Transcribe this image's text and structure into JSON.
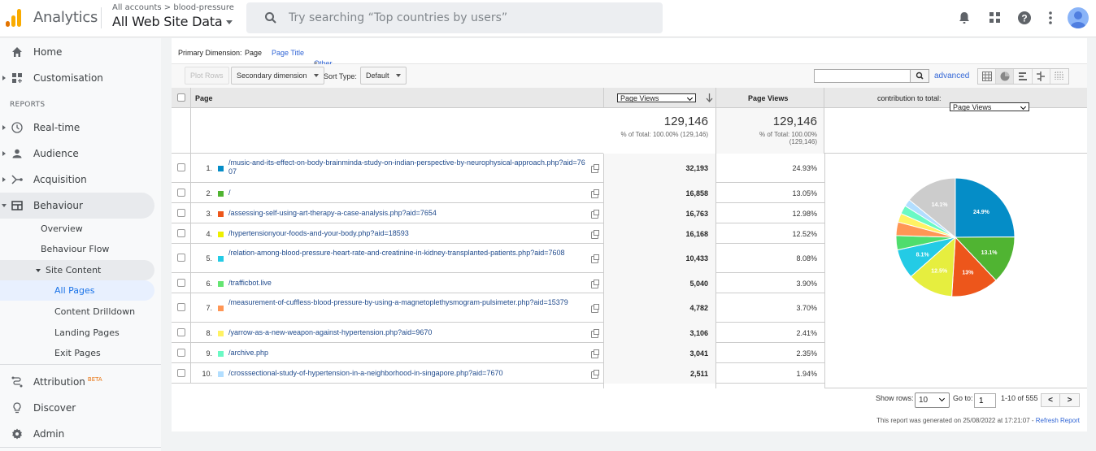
{
  "header": {
    "app_title": "Analytics",
    "breadcrumb": "All accounts > blood-pressure",
    "property": "All Web Site Data",
    "search_placeholder": "Try searching “Top countries by users”",
    "icons": [
      "bell-icon",
      "apps-grid-icon",
      "help-icon",
      "more-vert-icon",
      "account-avatar-icon"
    ]
  },
  "sidebar": {
    "top_items": [
      {
        "label": "Home",
        "icon": "home-icon"
      },
      {
        "label": "Customisation",
        "icon": "dashboard-icon"
      }
    ],
    "reports_label": "REPORTS",
    "report_items": [
      {
        "label": "Real-time",
        "icon": "clock-icon"
      },
      {
        "label": "Audience",
        "icon": "person-icon"
      },
      {
        "label": "Acquisition",
        "icon": "acquisition-icon"
      },
      {
        "label": "Behaviour",
        "icon": "behaviour-icon"
      }
    ],
    "behaviour_sub": [
      "Overview",
      "Behaviour Flow",
      "Site Content"
    ],
    "site_content_sub": [
      "All Pages",
      "Content Drilldown",
      "Landing Pages",
      "Exit Pages"
    ],
    "bottom_items": [
      {
        "label": "Attribution",
        "badge": "BETA",
        "icon": "attribution-icon"
      },
      {
        "label": "Discover",
        "icon": "lightbulb-icon"
      },
      {
        "label": "Admin",
        "icon": "gear-icon"
      }
    ]
  },
  "report": {
    "primary_dimension_label": "Primary Dimension:",
    "dimensions": {
      "active": "Page",
      "page_title": "Page Title",
      "other": "Other"
    },
    "toolbar": {
      "plot_rows": "Plot Rows",
      "secondary_dimension": "Secondary dimension",
      "sort_type_label": "Sort Type:",
      "sort_type_value": "Default",
      "advanced": "advanced",
      "search_value": ""
    },
    "columns": {
      "page": "Page",
      "metric_select": "Page Views",
      "metric_header": "Page Views",
      "contribution_label": "contribution to total:",
      "contribution_select": "Page Views"
    },
    "totals": {
      "value1": "129,146",
      "sub1": "% of Total: 100.00% (129,146)",
      "value2": "129,146",
      "sub2a": "% of Total: 100.00%",
      "sub2b": "(129,146)"
    },
    "rows": [
      {
        "index": "1.",
        "page": "/music-and-its-effect-on-body-brainminda-study-on-indian-perspective-by-neurophysical-approach.php?aid=7607",
        "views": "32,193",
        "pct": "24.93%",
        "color": "#058dc7"
      },
      {
        "index": "2.",
        "page": "/",
        "views": "16,858",
        "pct": "13.05%",
        "color": "#50b432"
      },
      {
        "index": "3.",
        "page": "/assessing-self-using-art-therapy-a-case-analysis.php?aid=7654",
        "views": "16,763",
        "pct": "12.98%",
        "color": "#ed561b"
      },
      {
        "index": "4.",
        "page": "/hypertensionyour-foods-and-your-body.php?aid=18593",
        "views": "16,168",
        "pct": "12.52%",
        "color": "#edef00"
      },
      {
        "index": "5.",
        "page": "/relation-among-blood-pressure-heart-rate-and-creatinine-in-kidney-transplanted-patients.php?aid=7608",
        "views": "10,433",
        "pct": "8.08%",
        "color": "#24cbe5"
      },
      {
        "index": "6.",
        "page": "/trafficbot.live",
        "views": "5,040",
        "pct": "3.90%",
        "color": "#64e572"
      },
      {
        "index": "7.",
        "page": "/measurement-of-cuffless-blood-pressure-by-using-a-magnetoplethysmogram-pulsimeter.php?aid=15379",
        "views": "4,782",
        "pct": "3.70%",
        "color": "#ff9655"
      },
      {
        "index": "8.",
        "page": "/yarrow-as-a-new-weapon-against-hypertension.php?aid=9670",
        "views": "3,106",
        "pct": "2.41%",
        "color": "#fff263"
      },
      {
        "index": "9.",
        "page": "/archive.php",
        "views": "3,041",
        "pct": "2.35%",
        "color": "#6af9c4"
      },
      {
        "index": "10.",
        "page": "/crosssectional-study-of-hypertension-in-a-neighborhood-in-singapore.php?aid=7670",
        "views": "2,511",
        "pct": "1.94%",
        "color": "#b2deff"
      }
    ],
    "pagination": {
      "show_rows_label": "Show rows:",
      "show_rows_value": "10",
      "goto_label": "Go to:",
      "goto_value": "1",
      "range": "1-10 of 555",
      "prev": "<",
      "next": ">"
    },
    "generated_text": "This report was generated on 25/08/2022 at 17:21:07 - ",
    "refresh_link": "Refresh Report"
  },
  "chart_data": {
    "type": "pie",
    "title": "contribution to total: Page Views",
    "slices": [
      {
        "label": "Row 1",
        "value": 24.93,
        "display": "24.9%",
        "color": "#058dc7"
      },
      {
        "label": "Row 2",
        "value": 13.05,
        "display": "13.1%",
        "color": "#50b432"
      },
      {
        "label": "Row 3",
        "value": 12.98,
        "display": "13%",
        "color": "#ed561b"
      },
      {
        "label": "Row 4",
        "value": 12.52,
        "display": "12.5%",
        "color": "#e6ee3f"
      },
      {
        "label": "Row 5",
        "value": 8.08,
        "display": "8.1%",
        "color": "#24cbe5"
      },
      {
        "label": "Row 6",
        "value": 3.9,
        "display": "",
        "color": "#4fdd6d"
      },
      {
        "label": "Row 7",
        "value": 3.7,
        "display": "",
        "color": "#ff9655"
      },
      {
        "label": "Row 8",
        "value": 2.41,
        "display": "",
        "color": "#fff263"
      },
      {
        "label": "Row 9",
        "value": 2.35,
        "display": "",
        "color": "#6af9c4"
      },
      {
        "label": "Row 10",
        "value": 1.94,
        "display": "",
        "color": "#b2deff"
      },
      {
        "label": "Other",
        "value": 14.14,
        "display": "14.1%",
        "color": "#cccccc"
      }
    ]
  }
}
